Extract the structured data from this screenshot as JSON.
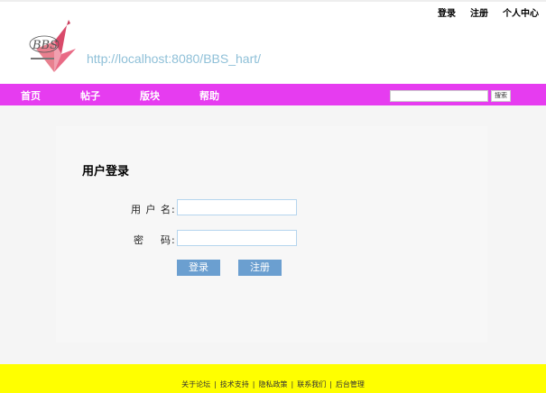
{
  "header": {
    "top_links": {
      "login": "登录",
      "register": "注册",
      "user_center": "个人中心"
    },
    "logo_text": "BBS",
    "site_url": "http://localhost:8080/BBS_hart/"
  },
  "nav": {
    "items": [
      "首页",
      "帖子",
      "版块",
      "帮助"
    ],
    "search_placeholder": "",
    "search_button": "搜索"
  },
  "login_form": {
    "title": "用户登录",
    "username_label": "用 户 名:",
    "username_value": "",
    "password_label": "密    码:",
    "password_value": "",
    "login_button": "登录",
    "register_button": "注册"
  },
  "footer": {
    "links": [
      "关于论坛",
      "技术支持",
      "隐私政策",
      "联系我们",
      "后台管理"
    ],
    "separator": "|"
  },
  "colors": {
    "nav_bg": "#e63cf0",
    "footer_bg": "#ffff00",
    "button_bg": "#6b9fd0",
    "url_text": "#8fc0d8"
  }
}
